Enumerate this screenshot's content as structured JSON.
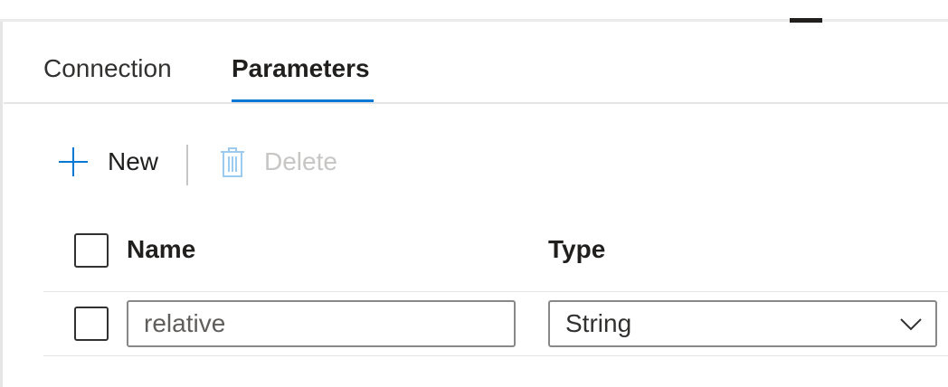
{
  "tabs": [
    {
      "label": "Connection",
      "active": false
    },
    {
      "label": "Parameters",
      "active": true
    }
  ],
  "toolbar": {
    "new_label": "New",
    "new_icon": "plus-icon",
    "delete_label": "Delete",
    "delete_icon": "trash-icon",
    "delete_enabled": false
  },
  "table": {
    "columns": [
      "Name",
      "Type"
    ],
    "rows": [
      {
        "selected": false,
        "name": "relative",
        "type": "String"
      }
    ]
  },
  "colors": {
    "accent": "#0078d4",
    "disabled_text": "#c8c6c4",
    "text": "#201f1e",
    "border": "#8a8886"
  }
}
